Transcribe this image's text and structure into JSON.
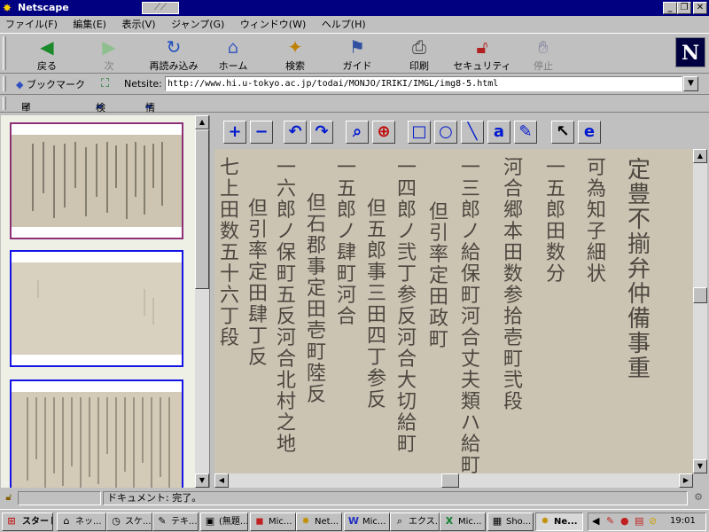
{
  "window": {
    "title": "Netscape"
  },
  "menu": [
    "ファイル(F)",
    "編集(E)",
    "表示(V)",
    "ジャンプ(G)",
    "ウィンドウ(W)",
    "ヘルプ(H)"
  ],
  "toolbar": [
    {
      "label": "戻る",
      "icon": "back-arrow-icon"
    },
    {
      "label": "次",
      "icon": "forward-arrow-icon"
    },
    {
      "label": "再読み込み",
      "icon": "reload-icon"
    },
    {
      "label": "ホーム",
      "icon": "home-icon"
    },
    {
      "label": "検索",
      "icon": "search-icon"
    },
    {
      "label": "ガイド",
      "icon": "guide-icon"
    },
    {
      "label": "印刷",
      "icon": "print-icon"
    },
    {
      "label": "セキュリティ",
      "icon": "lock-icon"
    },
    {
      "label": "停止",
      "icon": "stop-icon"
    }
  ],
  "location": {
    "bookmark_label": "ブックマーク",
    "netsite_label": "Netsite:",
    "url": "http://www.hi.u-tokyo.ac.jp/todai/MONJO/IRIKI/IMGL/img8-5.html"
  },
  "personal": [
    "インターネット",
    "検索",
    "情報"
  ],
  "status": {
    "text": "ドキュメント: 完了。"
  },
  "taskbar": {
    "start": "スタート",
    "tasks": [
      "ネッ...",
      "スケ...",
      "テキ...",
      "(無題...",
      "Mic...",
      "Net...",
      "Mic...",
      "エクス...",
      "Mic...",
      "Sho...",
      "Ne..."
    ],
    "clock": "19:01"
  },
  "document_columns": [
    "定豊 不揃弁仲備事重",
    "可為知子細状",
    "一 五郎田数分",
    "河合郷本田数参拾壱町弐段",
    "一 三郎ノ給保町 河合 丈夫類ハ給町",
    "但 引率定田政町",
    "一 四郎ノ 弐丁参反 河合 大切給町",
    "但 五郎事三田四丁参反",
    "一 五郎ノ 肆町 河合",
    "但 石郡事定田壱町陸反",
    "一 六郎ノ 保町五反 河合 北村之地",
    "但 引率定田 肆丁反",
    "七 上田数 五十六丁 段"
  ]
}
